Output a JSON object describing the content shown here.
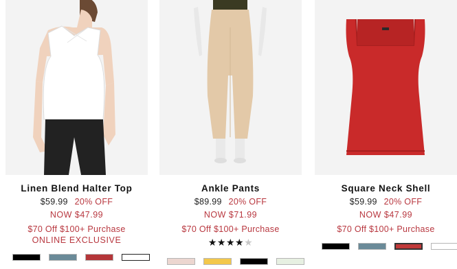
{
  "products": [
    {
      "name": "Linen Blend Halter Top",
      "original_price": "$59.99",
      "discount": "20% OFF",
      "now_price": "NOW $47.99",
      "promo": "$70 Off $100+ Purchase",
      "badge": "ONLINE EXCLUSIVE",
      "swatches": [
        "#000000",
        "#6a8a98",
        "#b43639",
        "#ffffff"
      ]
    },
    {
      "name": "Ankle Pants",
      "original_price": "$89.99",
      "discount": "20% OFF",
      "now_price": "NOW $71.99",
      "promo": "$70 Off $100+ Purchase",
      "rating": 4,
      "rating_max": 5,
      "swatches": [
        "#ecd6d0",
        "#f3c84b",
        "#000000",
        "#e7f0e2"
      ]
    },
    {
      "name": "Square Neck Shell",
      "original_price": "$59.99",
      "discount": "20% OFF",
      "now_price": "NOW $47.99",
      "promo": "$70 Off $100+ Purchase",
      "swatches": [
        "#000000",
        "#6a8a98",
        "#c13a3a",
        "#ffffff"
      ]
    }
  ]
}
